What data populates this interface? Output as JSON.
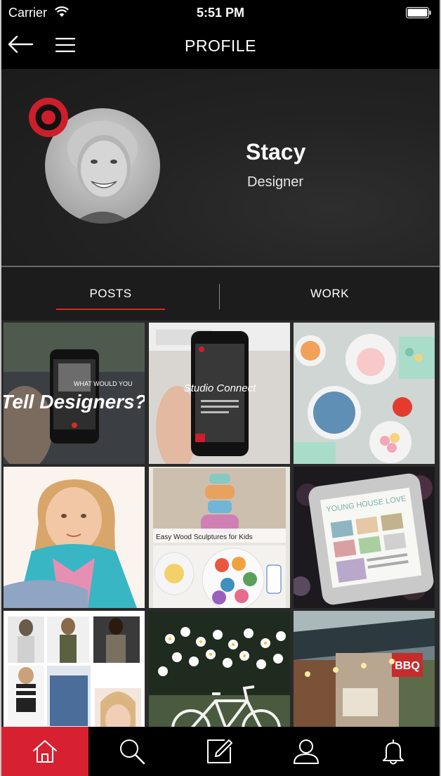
{
  "status_bar": {
    "carrier": "Carrier",
    "time": "5:51 PM"
  },
  "nav": {
    "title": "PROFILE"
  },
  "profile": {
    "name": "Stacy",
    "role": "Designer"
  },
  "tabs": [
    {
      "label": "POSTS",
      "active": true
    },
    {
      "label": "WORK",
      "active": false
    }
  ],
  "posts": [
    {
      "text": "Tell Designers?",
      "subtext": "WHAT WOULD YOU"
    },
    {
      "text": "Studio Connect"
    },
    {
      "text": ""
    },
    {
      "text": ""
    },
    {
      "text": "Easy Wood Sculptures for Kids"
    },
    {
      "text": "YOUNG HOUSE LOVE"
    },
    {
      "text": ""
    },
    {
      "text": ""
    },
    {
      "text": "BBQ"
    }
  ],
  "tab_bar": {
    "items": [
      {
        "icon": "home-icon",
        "active": true
      },
      {
        "icon": "search-icon",
        "active": false
      },
      {
        "icon": "compose-icon",
        "active": false
      },
      {
        "icon": "profile-icon",
        "active": false
      },
      {
        "icon": "bell-icon",
        "active": false
      }
    ]
  },
  "colors": {
    "accent": "#d72130",
    "tab_underline": "#d62a2a",
    "background": "#1a1a1a"
  }
}
